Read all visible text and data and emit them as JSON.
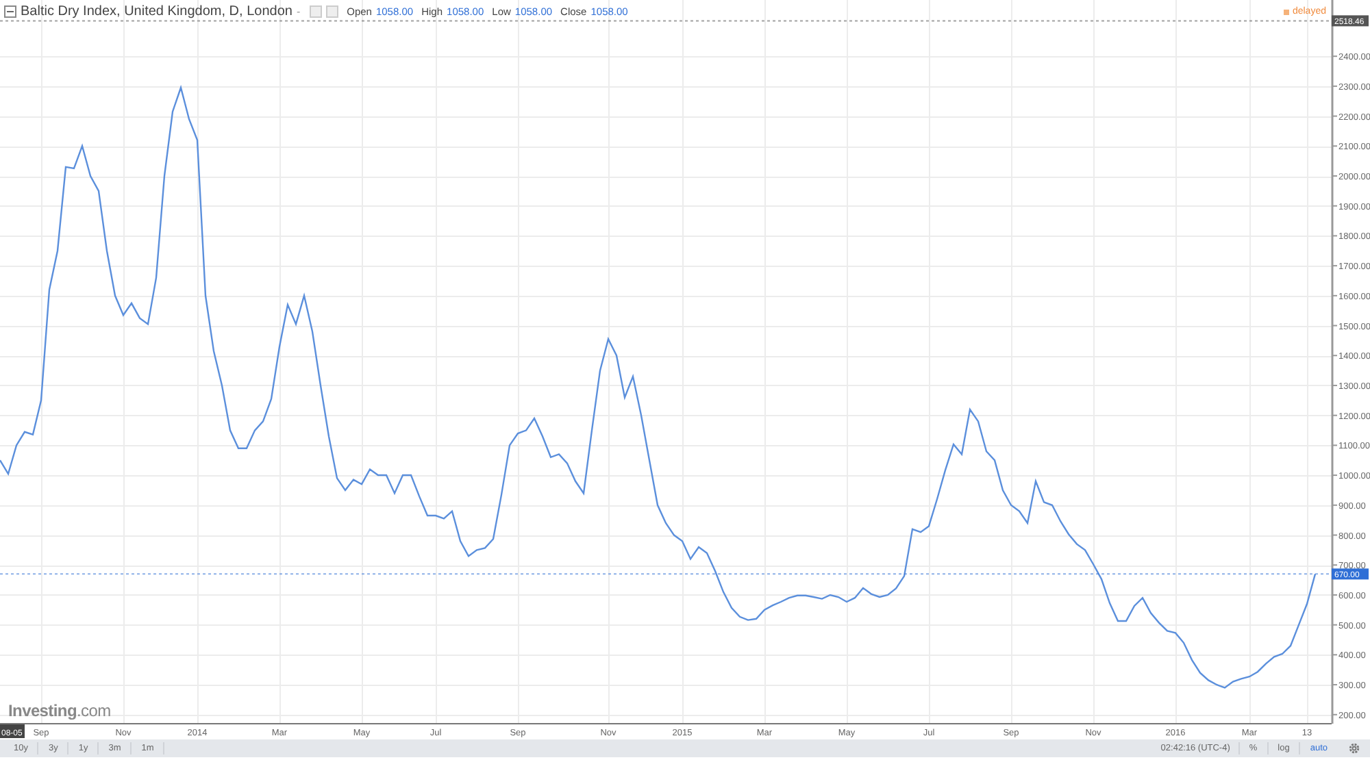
{
  "header": {
    "title": "Baltic Dry Index, United Kingdom, D, London",
    "dropdown": "-",
    "quotes": [
      {
        "label": "Open",
        "value": "1058.00"
      },
      {
        "label": "High",
        "value": "1058.00"
      },
      {
        "label": "Low",
        "value": "1058.00"
      },
      {
        "label": "Close",
        "value": "1058.00"
      }
    ],
    "status": "delayed"
  },
  "chart": {
    "logo": "**Investing**.com",
    "markers": [
      {
        "kind": "date",
        "text": "08-05"
      }
    ],
    "chart_data": {
      "type": "line",
      "ylim": [
        172,
        2588
      ],
      "grid": true,
      "ref_lines": [
        {
          "axis": "y",
          "value": 2518.46,
          "label": "2518.46",
          "color": "#555555"
        },
        {
          "axis": "y",
          "value": 670,
          "label": "670.00",
          "color": "#2f6fd6"
        }
      ],
      "categories": [
        null,
        null,
        null,
        null,
        null,
        "Sep",
        null,
        null,
        null,
        null,
        null,
        null,
        null,
        null,
        null,
        "Nov",
        null,
        null,
        null,
        null,
        null,
        null,
        null,
        null,
        "2014",
        null,
        null,
        null,
        null,
        null,
        null,
        null,
        null,
        null,
        "Mar",
        null,
        null,
        null,
        null,
        null,
        null,
        null,
        null,
        null,
        "May",
        null,
        null,
        null,
        null,
        null,
        null,
        null,
        null,
        "Jul",
        null,
        null,
        null,
        null,
        null,
        null,
        null,
        null,
        null,
        "Sep",
        null,
        null,
        null,
        null,
        null,
        null,
        null,
        null,
        null,
        null,
        "Nov",
        null,
        null,
        null,
        null,
        null,
        null,
        null,
        null,
        "2015",
        null,
        null,
        null,
        null,
        null,
        null,
        null,
        null,
        null,
        "Mar",
        null,
        null,
        null,
        null,
        null,
        null,
        null,
        null,
        null,
        "May",
        null,
        null,
        null,
        null,
        null,
        null,
        null,
        null,
        null,
        "Jul",
        null,
        null,
        null,
        null,
        null,
        null,
        null,
        null,
        null,
        "Sep",
        null,
        null,
        null,
        null,
        null,
        null,
        null,
        null,
        null,
        "Nov",
        null,
        null,
        null,
        null,
        null,
        null,
        null,
        null,
        null,
        "2016",
        null,
        null,
        null,
        null,
        null,
        null,
        null,
        null,
        "Mar",
        null,
        null,
        null,
        null,
        null,
        null,
        "13",
        null
      ],
      "series": [
        {
          "color": "#5b8fdc",
          "values": [
            1050,
            1005,
            1100,
            1145,
            1136,
            1250,
            1620,
            1750,
            2030,
            2025,
            2100,
            2000,
            1950,
            1750,
            1600,
            1535,
            1575,
            1525,
            1505,
            1660,
            2000,
            2215,
            2295,
            2190,
            2120,
            1600,
            1415,
            1300,
            1150,
            1090,
            1090,
            1150,
            1180,
            1255,
            1430,
            1570,
            1505,
            1600,
            1480,
            1300,
            1130,
            990,
            950,
            985,
            970,
            1020,
            1000,
            1000,
            940,
            1000,
            1000,
            930,
            865,
            865,
            855,
            880,
            780,
            730,
            750,
            757,
            787,
            935,
            1100,
            1140,
            1150,
            1190,
            1130,
            1060,
            1070,
            1040,
            980,
            940,
            1150,
            1350,
            1455,
            1400,
            1260,
            1330,
            1200,
            1050,
            900,
            840,
            800,
            780,
            720,
            760,
            740,
            680,
            610,
            557,
            527,
            516,
            520,
            550,
            565,
            577,
            590,
            598,
            598,
            593,
            587,
            600,
            593,
            577,
            590,
            623,
            603,
            593,
            600,
            622,
            663,
            820,
            810,
            830,
            920,
            1017,
            1103,
            1070,
            1220,
            1180,
            1080,
            1050,
            950,
            900,
            880,
            840,
            980,
            910,
            900,
            847,
            803,
            770,
            750,
            703,
            653,
            573,
            513,
            513,
            563,
            590,
            540,
            507,
            480,
            473,
            440,
            383,
            340,
            315,
            300,
            290,
            310,
            320,
            327,
            343,
            370,
            393,
            403,
            430,
            500,
            570,
            670
          ]
        }
      ],
      "yticks": [
        {
          "value": 200,
          "label": "200.00"
        },
        {
          "value": 300,
          "label": "300.00"
        },
        {
          "value": 400,
          "label": "400.00"
        },
        {
          "value": 500,
          "label": "500.00"
        },
        {
          "value": 600,
          "label": "600.00"
        },
        {
          "value": 700,
          "label": "700.00"
        },
        {
          "value": 800,
          "label": "800.00"
        },
        {
          "value": 900,
          "label": "900.00"
        },
        {
          "value": 1000,
          "label": "1000.00"
        },
        {
          "value": 1100,
          "label": "1100.00"
        },
        {
          "value": 1200,
          "label": "1200.00"
        },
        {
          "value": 1300,
          "label": "1300.00"
        },
        {
          "value": 1400,
          "label": "1400.00"
        },
        {
          "value": 1500,
          "label": "1500.00"
        },
        {
          "value": 1600,
          "label": "1600.00"
        },
        {
          "value": 1700,
          "label": "1700.00"
        },
        {
          "value": 1800,
          "label": "1800.00"
        },
        {
          "value": 1900,
          "label": "1900.00"
        },
        {
          "value": 2000,
          "label": "2000.00"
        },
        {
          "value": 2100,
          "label": "2100.00"
        },
        {
          "value": 2200,
          "label": "2200.00"
        },
        {
          "value": 2300,
          "label": "2300.00"
        },
        {
          "value": 2400,
          "label": "2400.00"
        }
      ]
    }
  },
  "toolbar": {
    "ranges": [
      {
        "label": "10y",
        "selected": false
      },
      {
        "label": "3y",
        "selected": false
      },
      {
        "label": "1y",
        "selected": false
      },
      {
        "label": "3m",
        "selected": false
      },
      {
        "label": "1m",
        "selected": false
      }
    ],
    "time": "02:42:16 (UTC-4)",
    "options": [
      {
        "label": "%",
        "selected": false
      },
      {
        "label": "log",
        "selected": false
      },
      {
        "label": "auto",
        "selected": true
      }
    ]
  }
}
